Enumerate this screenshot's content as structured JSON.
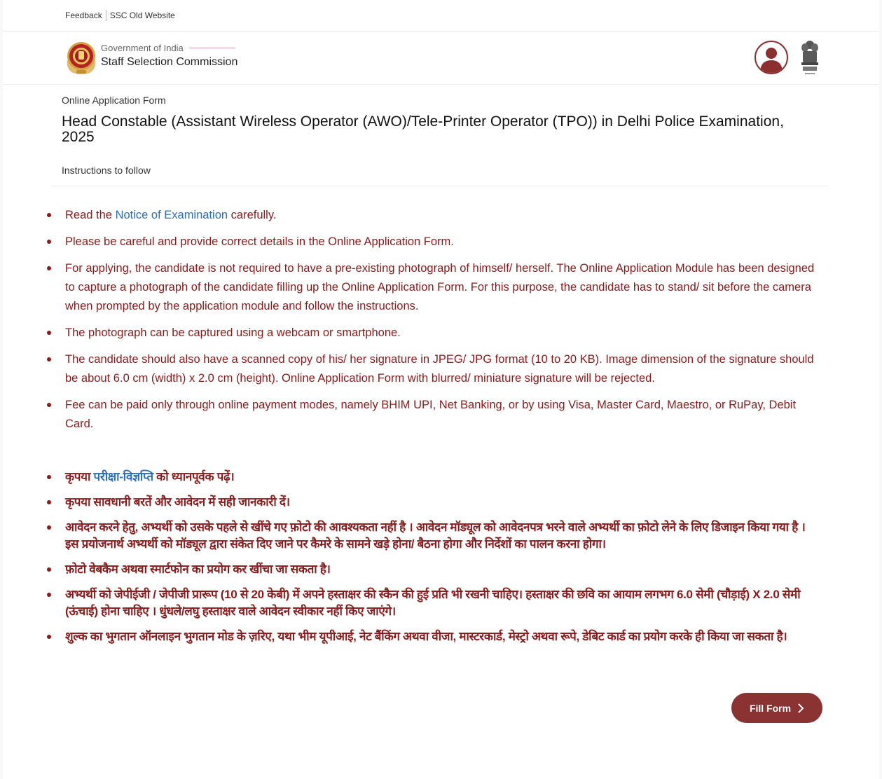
{
  "topbar": {
    "feedback": "Feedback",
    "old_site": "SSC Old Website"
  },
  "header": {
    "gov": "Government of India",
    "org": "Staff Selection Commission",
    "logo_icon": "ssc-logo-icon",
    "user_icon": "user-avatar-icon",
    "emblem_icon": "national-emblem-icon",
    "accent": "#8b1a1a"
  },
  "form": {
    "type": "Online Application Form",
    "title": "Head Constable (Assistant Wireless Operator (AWO)/Tele-Printer Operator (TPO)) in Delhi Police Examination, 2025",
    "instructions_label": "Instructions to follow"
  },
  "instructions_en": {
    "item1": {
      "before": "Read the ",
      "link": "Notice of Examination",
      "after": " carefully."
    },
    "item2": "Please be careful and provide correct details in the Online Application Form.",
    "item3": "For applying, the candidate is not required to have a pre-existing photograph of himself/ herself. The Online Application Module has been designed to capture a photograph of the candidate filling up the Online Application Form. For this purpose, the candidate has to stand/ sit before the camera when prompted by the application module and follow the instructions.",
    "item4": "The photograph can be captured using a webcam or smartphone.",
    "item5": "The candidate should also have a scanned copy of his/ her signature in JPEG/ JPG format (10 to 20 KB). Image dimension of the signature should be about 6.0 cm (width) x 2.0 cm (height). Online Application Form with blurred/ miniature signature will be rejected.",
    "item6": "Fee can be paid only through online payment modes, namely BHIM UPI, Net Banking, or by using Visa, Master Card, Maestro, or RuPay, Debit Card."
  },
  "instructions_hi": {
    "item1": {
      "before": "कृपया ",
      "link": "परीक्षा-विज्ञप्ति",
      "after": " को ध्यानपूर्वक पढ़ें।"
    },
    "item2": "कृपया सावधानी बरतें और आवेदन में सही जानकारी दें।",
    "item3": "आवेदन करने हेतु, अभ्यर्थी को उसके पहले से खींचे गए फ़ोटो की आवश्यकता नहीं है । आवेदन मॉड्यूल को आवेदनपत्र भरने वाले अभ्यर्थी का फ़ोटो लेने के लिए डिजाइन किया गया है । इस प्रयोजनार्थ अभ्यर्थी को मॉड्यूल द्वारा संकेत दिए जाने पर कैमरे के सामने खड़े होना/ बैठना होगा और निर्देशों का पालन करना होगा।",
    "item4": "फ़ोटो वेबकैम अथवा स्मार्टफोन का प्रयोग कर खींचा जा सकता है।",
    "item5": "अभ्यर्थी को जेपीईजी / जेपीजी प्रारूप (10 से 20 केबी) में अपने हस्ताक्षर की स्कैन की हुई प्रति भी रखनी चाहिए। हस्ताक्षर की छवि का आयाम लगभग 6.0 सेमी (चौड़ाई) X 2.0 सेमी (ऊंचाई) होना चाहिए । धुंधले/लघु हस्ताक्षर वाले आवेदन स्वीकार नहीं किए जाएंगे।",
    "item6": "शुल्क का भुगतान ऑनलाइन भुगतान मोड के ज़रिए, यथा भीम यूपीआई, नेट बैंकिंग अथवा वीजा, मास्टरकार्ड, मेस्ट्रो अथवा रूपे, डेबिट कार्ड का प्रयोग करके ही किया जा सकता है।"
  },
  "actions": {
    "fill_form": "Fill Form",
    "button_color": "#8b3333"
  }
}
